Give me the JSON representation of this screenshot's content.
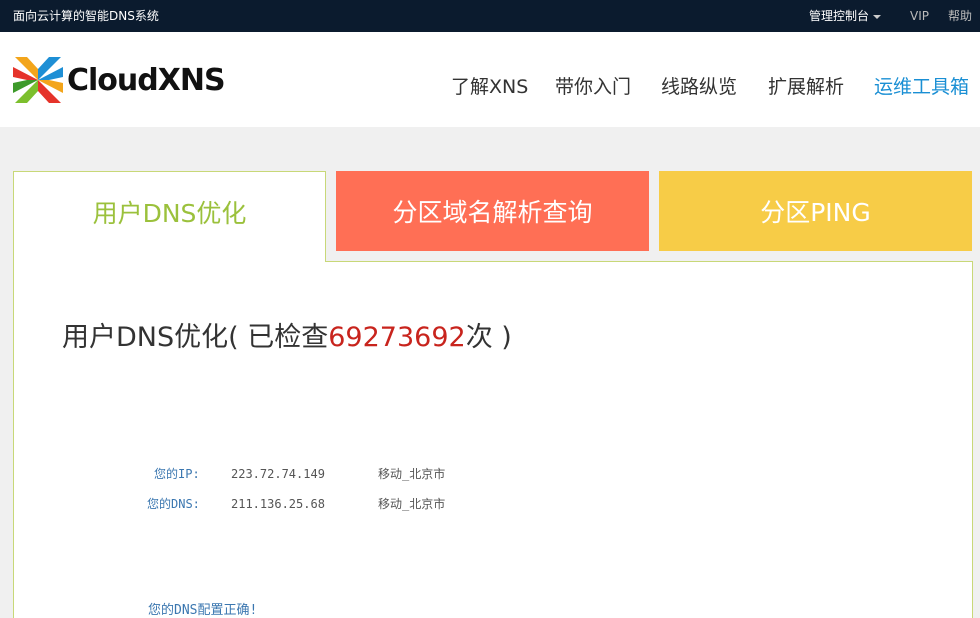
{
  "topbar": {
    "slogan": "面向云计算的智能DNS系统",
    "console_label": "管理控制台",
    "vip_label": "VIP",
    "help_label": "帮助"
  },
  "header": {
    "brand": "CloudXNS",
    "nav": [
      {
        "label": "了解XNS"
      },
      {
        "label": "带你入门"
      },
      {
        "label": "线路纵览"
      },
      {
        "label": "扩展解析"
      },
      {
        "label": "运维工具箱"
      }
    ]
  },
  "tabs": [
    {
      "label": "用户DNS优化"
    },
    {
      "label": "分区域名解析查询"
    },
    {
      "label": "分区PING"
    }
  ],
  "main": {
    "title_prefix": "用户DNS优化( 已检查",
    "checked_count": "69273692",
    "title_suffix": "次 )",
    "ip_label": "您的IP:",
    "ip_value": "223.72.74.149",
    "ip_location": "移动_北京市",
    "dns_label": "您的DNS:",
    "dns_value": "211.136.25.68",
    "dns_location": "移动_北京市",
    "result": "您的DNS配置正确!"
  },
  "colors": {
    "topbar_bg": "#0b1b2e",
    "active_nav": "#1a8fd4",
    "tab_active_text": "#9bc13c",
    "tab_2_bg": "#ff6f55",
    "tab_3_bg": "#f7cc47",
    "count_color": "#c8241d",
    "label_color": "#3b77b0"
  },
  "icons": {
    "logo": "pinwheel-logo-icon",
    "console_caret": "caret-down-icon"
  }
}
